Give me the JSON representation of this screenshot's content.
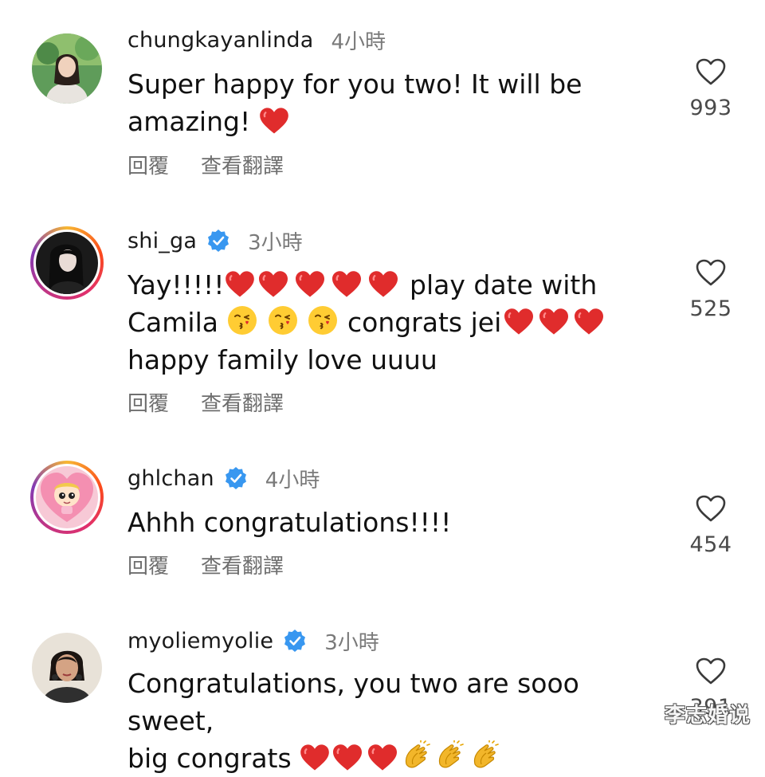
{
  "colors": {
    "username": "#1a1a1a",
    "meta_gray": "#7a7a7a",
    "verified_blue": "#3897f0",
    "heart_red": "#e02c2c"
  },
  "comments": [
    {
      "username": "chungkayanlinda",
      "verified": false,
      "time": "4小時",
      "text_lines": [
        "Super happy for you two! It will be",
        "amazing!"
      ],
      "reply_label": "回覆",
      "translate_label": "查看翻譯",
      "likes": "993",
      "avatar_icon": "avatar-photo-woman-green-background"
    },
    {
      "username": "shi_ga",
      "verified": true,
      "time": "3小時",
      "text_lines": [
        "Yay!!!!!",
        "play date with",
        "Camila",
        "congrats jei",
        "happy family love uuuu"
      ],
      "reply_label": "回覆",
      "translate_label": "查看翻譯",
      "likes": "525",
      "avatar_icon": "avatar-photo-woman-dark"
    },
    {
      "username": "ghlchan",
      "verified": true,
      "time": "4小時",
      "text_lines": [
        "Ahhh congratulations!!!!"
      ],
      "reply_label": "回覆",
      "translate_label": "查看翻譯",
      "likes": "454",
      "avatar_icon": "avatar-cartoon-character-pink"
    },
    {
      "username": "myoliemyolie",
      "verified": true,
      "time": "3小時",
      "text_lines": [
        "Congratulations, you two are sooo sweet,",
        "big congrats"
      ],
      "likes": "391",
      "avatar_icon": "avatar-photo-woman-earrings"
    }
  ],
  "watermark": "李志婚说"
}
